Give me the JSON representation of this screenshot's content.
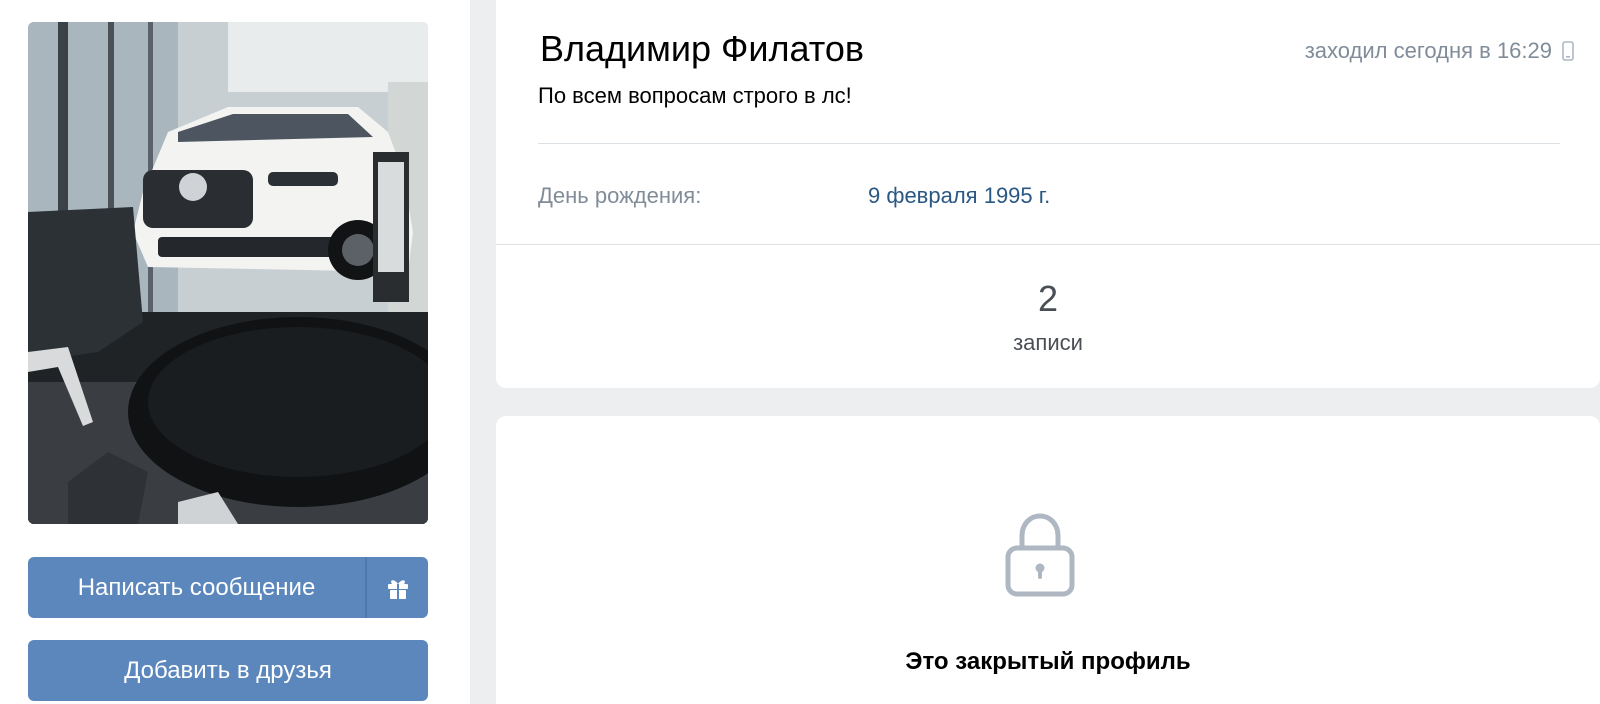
{
  "profile": {
    "name": "Владимир Филатов",
    "status": "По всем вопросам строго в лс!",
    "last_seen": "заходил сегодня в 16:29",
    "last_seen_icon": "mobile-phone-icon"
  },
  "details": {
    "birthday_label": "День рождения:",
    "birthday_value": "9 февраля 1995 г."
  },
  "counters": {
    "posts_count": "2",
    "posts_label": "записи"
  },
  "actions": {
    "message_label": "Написать сообщение",
    "gift_icon": "gift-icon",
    "add_friend_label": "Добавить в друзья"
  },
  "privacy": {
    "icon": "lock-icon",
    "closed_text": "Это закрытый профиль"
  },
  "colors": {
    "background": "#edeef0",
    "button": "#5c87bd",
    "link": "#2a5885",
    "muted": "#818c99"
  }
}
